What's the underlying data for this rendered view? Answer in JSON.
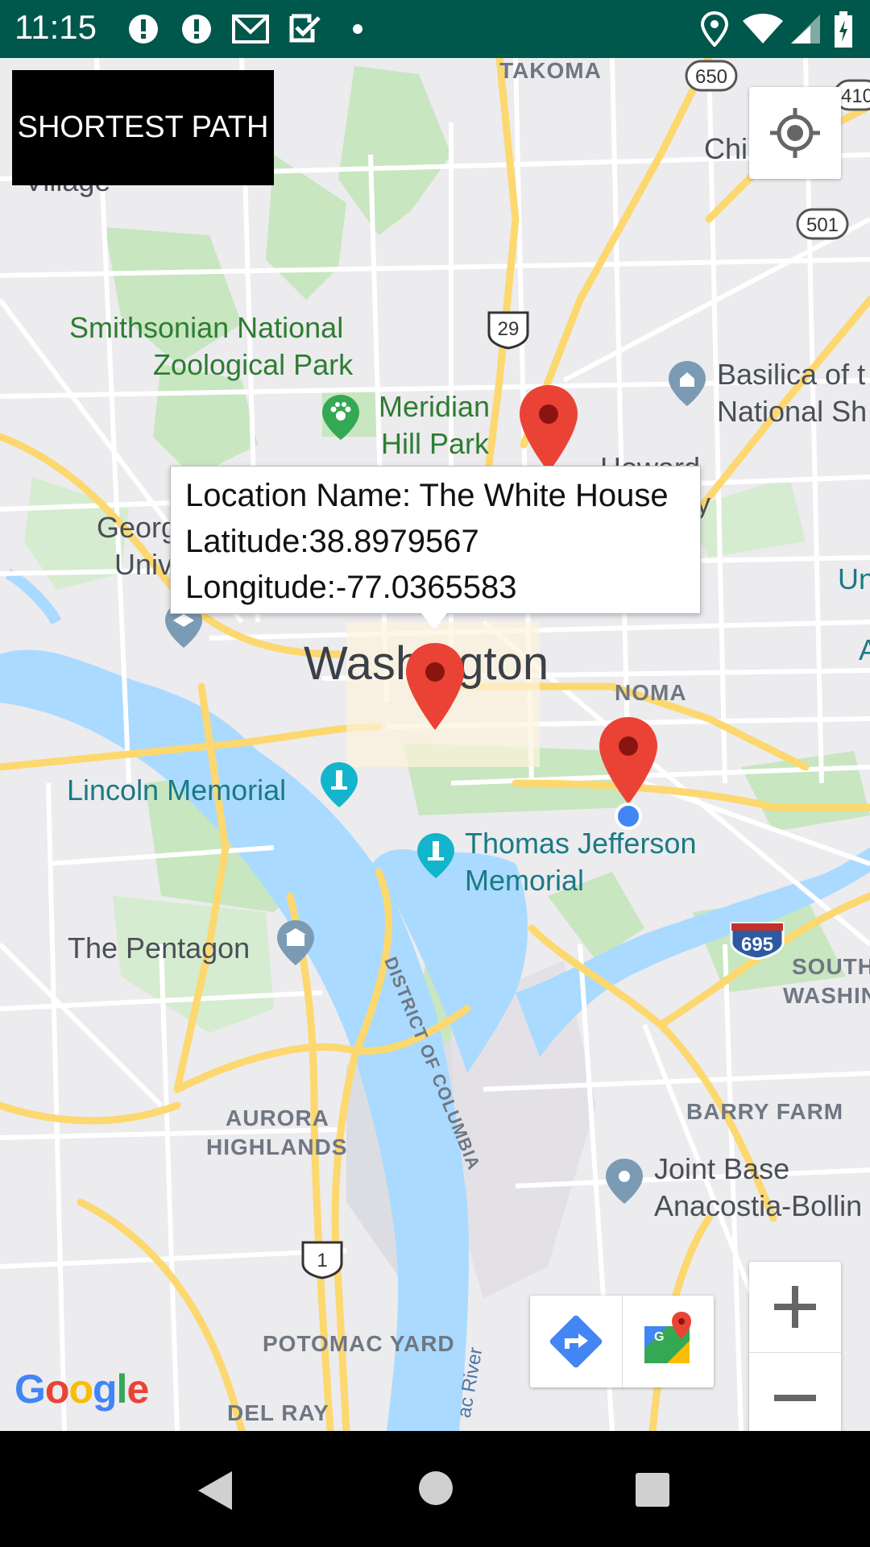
{
  "status_bar": {
    "time": "11:15",
    "icons": [
      "alert-icon",
      "alert-icon",
      "gmail-icon",
      "checkbox-icon",
      "dot-icon",
      "location-icon",
      "wifi-icon",
      "signal-icon",
      "battery-icon"
    ]
  },
  "app": {
    "shortest_path_label": "SHORTEST PATH"
  },
  "info_window": {
    "location_name": "Location Name: The White House",
    "latitude": "Latitude:38.8979567",
    "longitude": "Longitude:-77.0365583"
  },
  "map_labels": {
    "takoma": "TAKOMA",
    "chillum": "Chillum",
    "village": "Village",
    "zoo_line1": "Smithsonian National",
    "zoo_line2": "Zoological Park",
    "meridian_line1": "Meridian",
    "meridian_line2": "Hill Park",
    "basilica_line1": "Basilica of t",
    "basilica_line2": "National Sh",
    "howard_line1": "Howard",
    "howard_line2": "ity",
    "georgetown_line1": "Georg",
    "georgetown_line2": "Univ",
    "washington": "Washington",
    "noma": "NOMA",
    "un": "Un",
    "a": "A",
    "lincoln": "Lincoln Memorial",
    "jefferson_line1": "Thomas Jefferson",
    "jefferson_line2": "Memorial",
    "pentagon": "The Pentagon",
    "south_line1": "SOUTH",
    "south_line2": "WASHIN",
    "district": "DISTRICT OF COLUMBIA",
    "barry_farm": "BARRY FARM",
    "aurora_line1": "AURORA",
    "aurora_line2": "HIGHLANDS",
    "joint_line1": "Joint Base",
    "joint_line2": "Anacostia-Bollin",
    "potomac_yard": "POTOMAC YARD",
    "del_ray": "DEL RAY",
    "river": "ac River",
    "google": "Google"
  },
  "route_shields": {
    "r650": "650",
    "r410": "410",
    "r501": "501",
    "r29": "29",
    "r695": "695",
    "r1": "1"
  },
  "colors": {
    "status_bar": "#00574b",
    "map_bg": "#ecebee",
    "water": "#aadaff",
    "park": "#c8e6c0",
    "highway": "#fcd86f",
    "marker": "#ea4335",
    "my_location": "#4285f4"
  }
}
